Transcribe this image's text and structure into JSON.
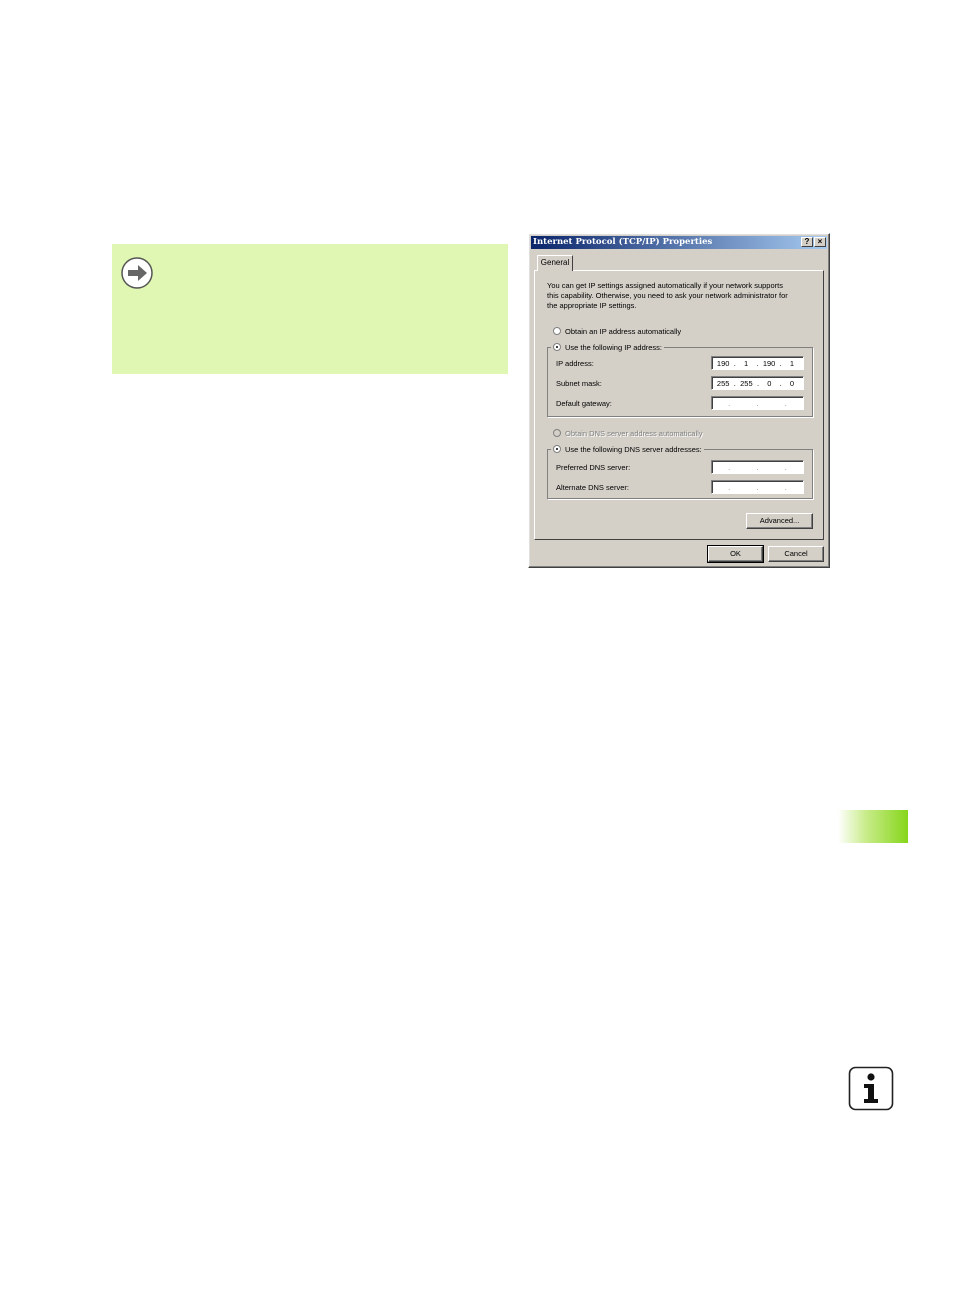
{
  "dialog": {
    "title": "Internet Protocol (TCP/IP) Properties",
    "help_button": "?",
    "close_button": "×",
    "tab_general": "General",
    "description": "You can get IP settings assigned automatically if your network supports\nthis capability. Otherwise, you need to ask your network administrator for\nthe appropriate IP settings.",
    "radio_obtain_ip": "Obtain an IP address automatically",
    "radio_use_ip": "Use the following IP address:",
    "ip_address_label": "IP address:",
    "ip_address": [
      "190",
      "1",
      "190",
      "1"
    ],
    "subnet_mask_label": "Subnet mask:",
    "subnet_mask": [
      "255",
      "255",
      "0",
      "0"
    ],
    "default_gateway_label": "Default gateway:",
    "radio_obtain_dns": "Obtain DNS server address automatically",
    "radio_use_dns": "Use the following DNS server addresses:",
    "preferred_dns_label": "Preferred DNS server:",
    "alternate_dns_label": "Alternate DNS server:",
    "advanced_button": "Advanced...",
    "ok_button": "OK",
    "cancel_button": "Cancel",
    "ip_separator": "."
  },
  "colors": {
    "note_background": "#dff7b2",
    "titlebar_start": "#0a246a",
    "titlebar_end": "#a6caf0",
    "dialog_face": "#d4d0c8",
    "side_tab_green": "#86d61a"
  },
  "icons": {
    "note": "arrow-right-circle-icon",
    "info": "info-icon"
  }
}
